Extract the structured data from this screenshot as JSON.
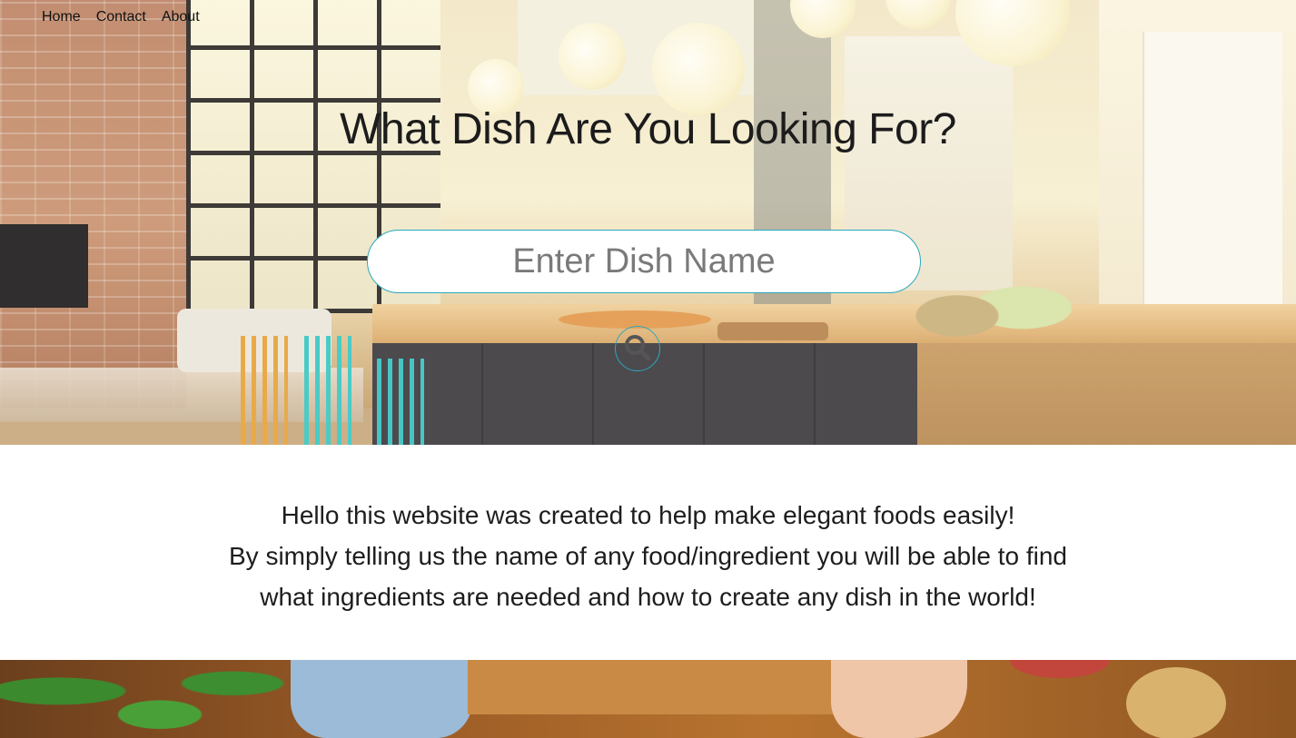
{
  "nav": {
    "items": [
      {
        "label": "Home"
      },
      {
        "label": "Contact"
      },
      {
        "label": "About"
      }
    ]
  },
  "hero": {
    "title": "What Dish Are You Looking For?",
    "search": {
      "placeholder": "Enter Dish Name",
      "value": "",
      "button_icon": "search-icon"
    }
  },
  "intro": {
    "lines": [
      "Hello this website was created to help make elegant foods easily!",
      "By simply telling us the name of any food/ingredient you will be able to find",
      "what ingredients are needed and how to create any dish in the world!"
    ]
  },
  "colors": {
    "accent": "#2aa8bd",
    "text": "#1c1c1c"
  }
}
